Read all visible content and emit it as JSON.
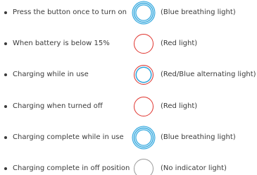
{
  "rows": [
    {
      "label": "Press the button once to turn on",
      "indicator": "blue-breathing-ring-icon",
      "desc": "(Blue breathing light)"
    },
    {
      "label": "When battery is below 15%",
      "indicator": "red-ring-icon",
      "desc": "(Red light)"
    },
    {
      "label": "Charging while in use",
      "indicator": "red-blue-ring-icon",
      "desc": "(Red/Blue alternating light)"
    },
    {
      "label": "Charging when turned off",
      "indicator": "red-ring-icon",
      "desc": "(Red light)"
    },
    {
      "label": "Charging complete while in use",
      "indicator": "blue-breathing-ring-icon",
      "desc": "(Blue breathing light)"
    },
    {
      "label": "Charging complete in off position",
      "indicator": "grey-ring-icon",
      "desc": "(No indicator light)"
    }
  ],
  "colors": {
    "blue": "#2aa3dc",
    "red": "#e0352f",
    "grey": "#9a9a9a",
    "text": "#3a3a3a"
  }
}
